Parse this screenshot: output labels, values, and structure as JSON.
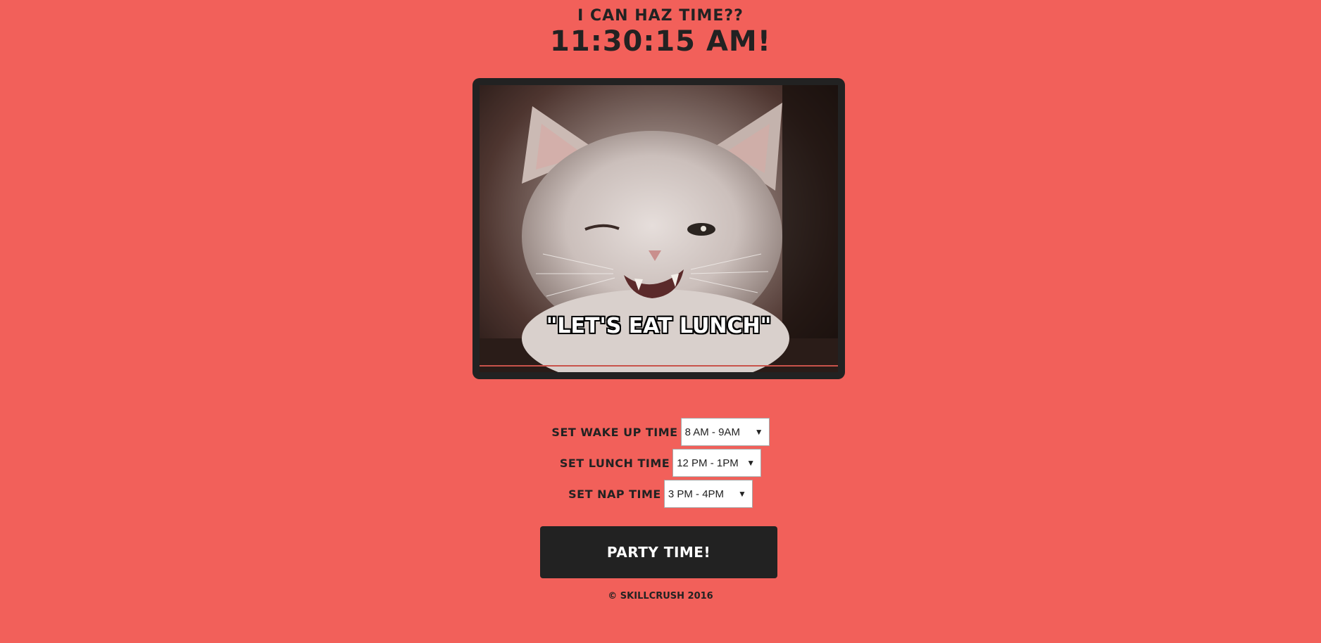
{
  "header": {
    "title": "I can haz time??",
    "clock": "11:30:15 AM!"
  },
  "photo": {
    "caption": "\"LET'S EAT LUNCH\""
  },
  "settings": {
    "wake": {
      "label": "Set wake up time",
      "value": "8 AM - 9AM"
    },
    "lunch": {
      "label": "Set lunch time",
      "value": "12 PM - 1PM"
    },
    "nap": {
      "label": "Set nap time",
      "value": "3 PM - 4PM"
    }
  },
  "button": {
    "label": "Party time!"
  },
  "footer": {
    "text": "© Skillcrush 2016"
  },
  "colors": {
    "background": "#f2605a",
    "text": "#222222",
    "button": "#222222"
  }
}
